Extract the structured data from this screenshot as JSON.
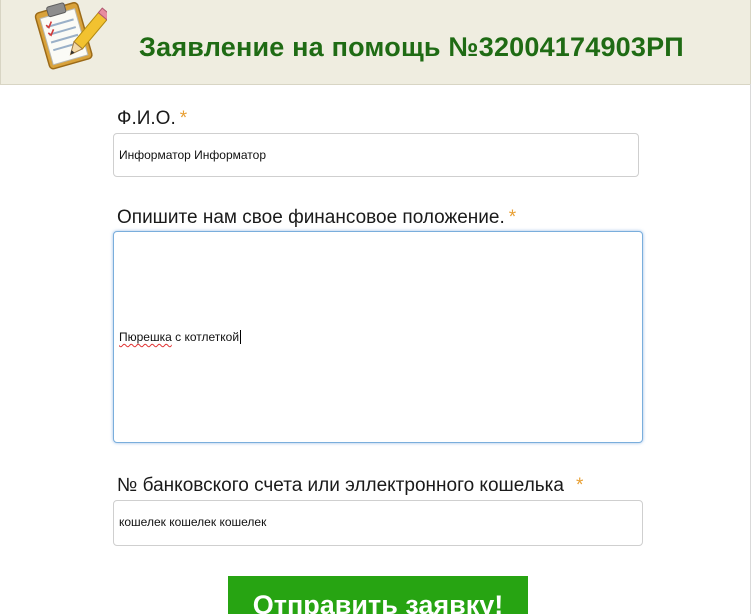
{
  "header": {
    "icon": "clipboard-pencil-icon",
    "title": "Заявление на помощь №32004174903РП"
  },
  "form": {
    "required_mark": "*",
    "fio": {
      "label": "Ф.И.О.",
      "value": "Информатор Информатор"
    },
    "situation": {
      "label": "Опишите нам свое финансовое положение.",
      "value_word1": "Пюрешка",
      "value_rest": " с котлеткой"
    },
    "account": {
      "label": "№ банковского счета или эллектронного кошелька",
      "value": "кошелек кошелек кошелек"
    },
    "submit_label": "Отправить заявку!"
  },
  "colors": {
    "header_bg": "#efede0",
    "title": "#1f6b14",
    "required": "#e8a035",
    "button": "#27a412"
  }
}
